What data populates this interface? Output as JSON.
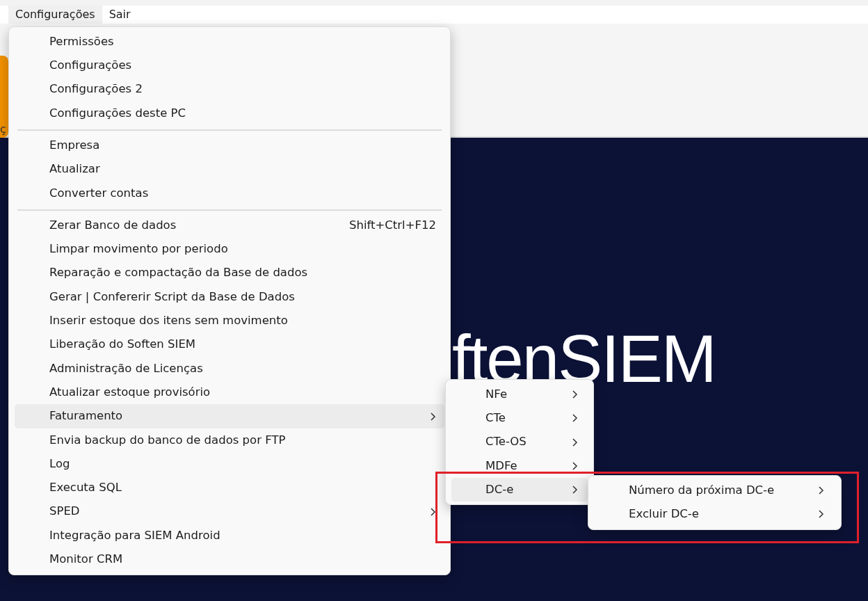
{
  "menubar": [
    {
      "label": "Configurações",
      "selected": true
    },
    {
      "label": "Sair",
      "selected": false
    }
  ],
  "toolbar": {
    "label": "ç"
  },
  "banner": {
    "text": "ftenSIEM"
  },
  "menu": {
    "groups": [
      [
        {
          "label": "Permissões",
          "has_submenu": false,
          "highlighted": false
        },
        {
          "label": "Configurações",
          "has_submenu": false,
          "highlighted": false
        },
        {
          "label": "Configurações 2",
          "has_submenu": false,
          "highlighted": false
        },
        {
          "label": "Configurações deste PC",
          "has_submenu": false,
          "highlighted": false
        }
      ],
      [
        {
          "label": "Empresa",
          "has_submenu": false,
          "highlighted": false
        },
        {
          "label": "Atualizar",
          "has_submenu": false,
          "highlighted": false
        },
        {
          "label": "Converter contas",
          "has_submenu": false,
          "highlighted": false
        }
      ],
      [
        {
          "label": "Zerar Banco de dados",
          "shortcut": "Shift+Ctrl+F12",
          "has_submenu": false,
          "highlighted": false
        },
        {
          "label": "Limpar movimento por periodo",
          "has_submenu": false,
          "highlighted": false
        },
        {
          "label": "Reparação e compactação da Base de dados",
          "has_submenu": false,
          "highlighted": false
        },
        {
          "label": "Gerar | Confererir Script da Base de Dados",
          "has_submenu": false,
          "highlighted": false
        },
        {
          "label": "Inserir estoque dos itens sem movimento",
          "has_submenu": false,
          "highlighted": false
        },
        {
          "label": "Liberação do Soften SIEM",
          "has_submenu": false,
          "highlighted": false
        },
        {
          "label": "Administração de Licenças",
          "has_submenu": false,
          "highlighted": false
        },
        {
          "label": "Atualizar estoque provisório",
          "has_submenu": false,
          "highlighted": false
        },
        {
          "label": "Faturamento",
          "has_submenu": true,
          "highlighted": true
        },
        {
          "label": "Envia backup do banco de dados por FTP",
          "has_submenu": false,
          "highlighted": false
        },
        {
          "label": "Log",
          "has_submenu": false,
          "highlighted": false
        },
        {
          "label": "Executa SQL",
          "has_submenu": false,
          "highlighted": false
        },
        {
          "label": "SPED",
          "has_submenu": true,
          "highlighted": false
        },
        {
          "label": "Integração para SIEM Android",
          "has_submenu": false,
          "highlighted": false
        },
        {
          "label": "Monitor CRM",
          "has_submenu": false,
          "highlighted": false
        }
      ]
    ]
  },
  "submenu": [
    {
      "label": "NFe",
      "has_submenu": true,
      "highlighted": false
    },
    {
      "label": "CTe",
      "has_submenu": true,
      "highlighted": false
    },
    {
      "label": "CTe-OS",
      "has_submenu": true,
      "highlighted": false
    },
    {
      "label": "MDFe",
      "has_submenu": true,
      "highlighted": false
    },
    {
      "label": "DC-e",
      "has_submenu": true,
      "highlighted": true
    }
  ],
  "submenu_2": [
    {
      "label": "Número da próxima DC-e",
      "has_submenu": true,
      "highlighted": false
    },
    {
      "label": "Excluir DC-e",
      "has_submenu": true,
      "highlighted": false
    }
  ]
}
